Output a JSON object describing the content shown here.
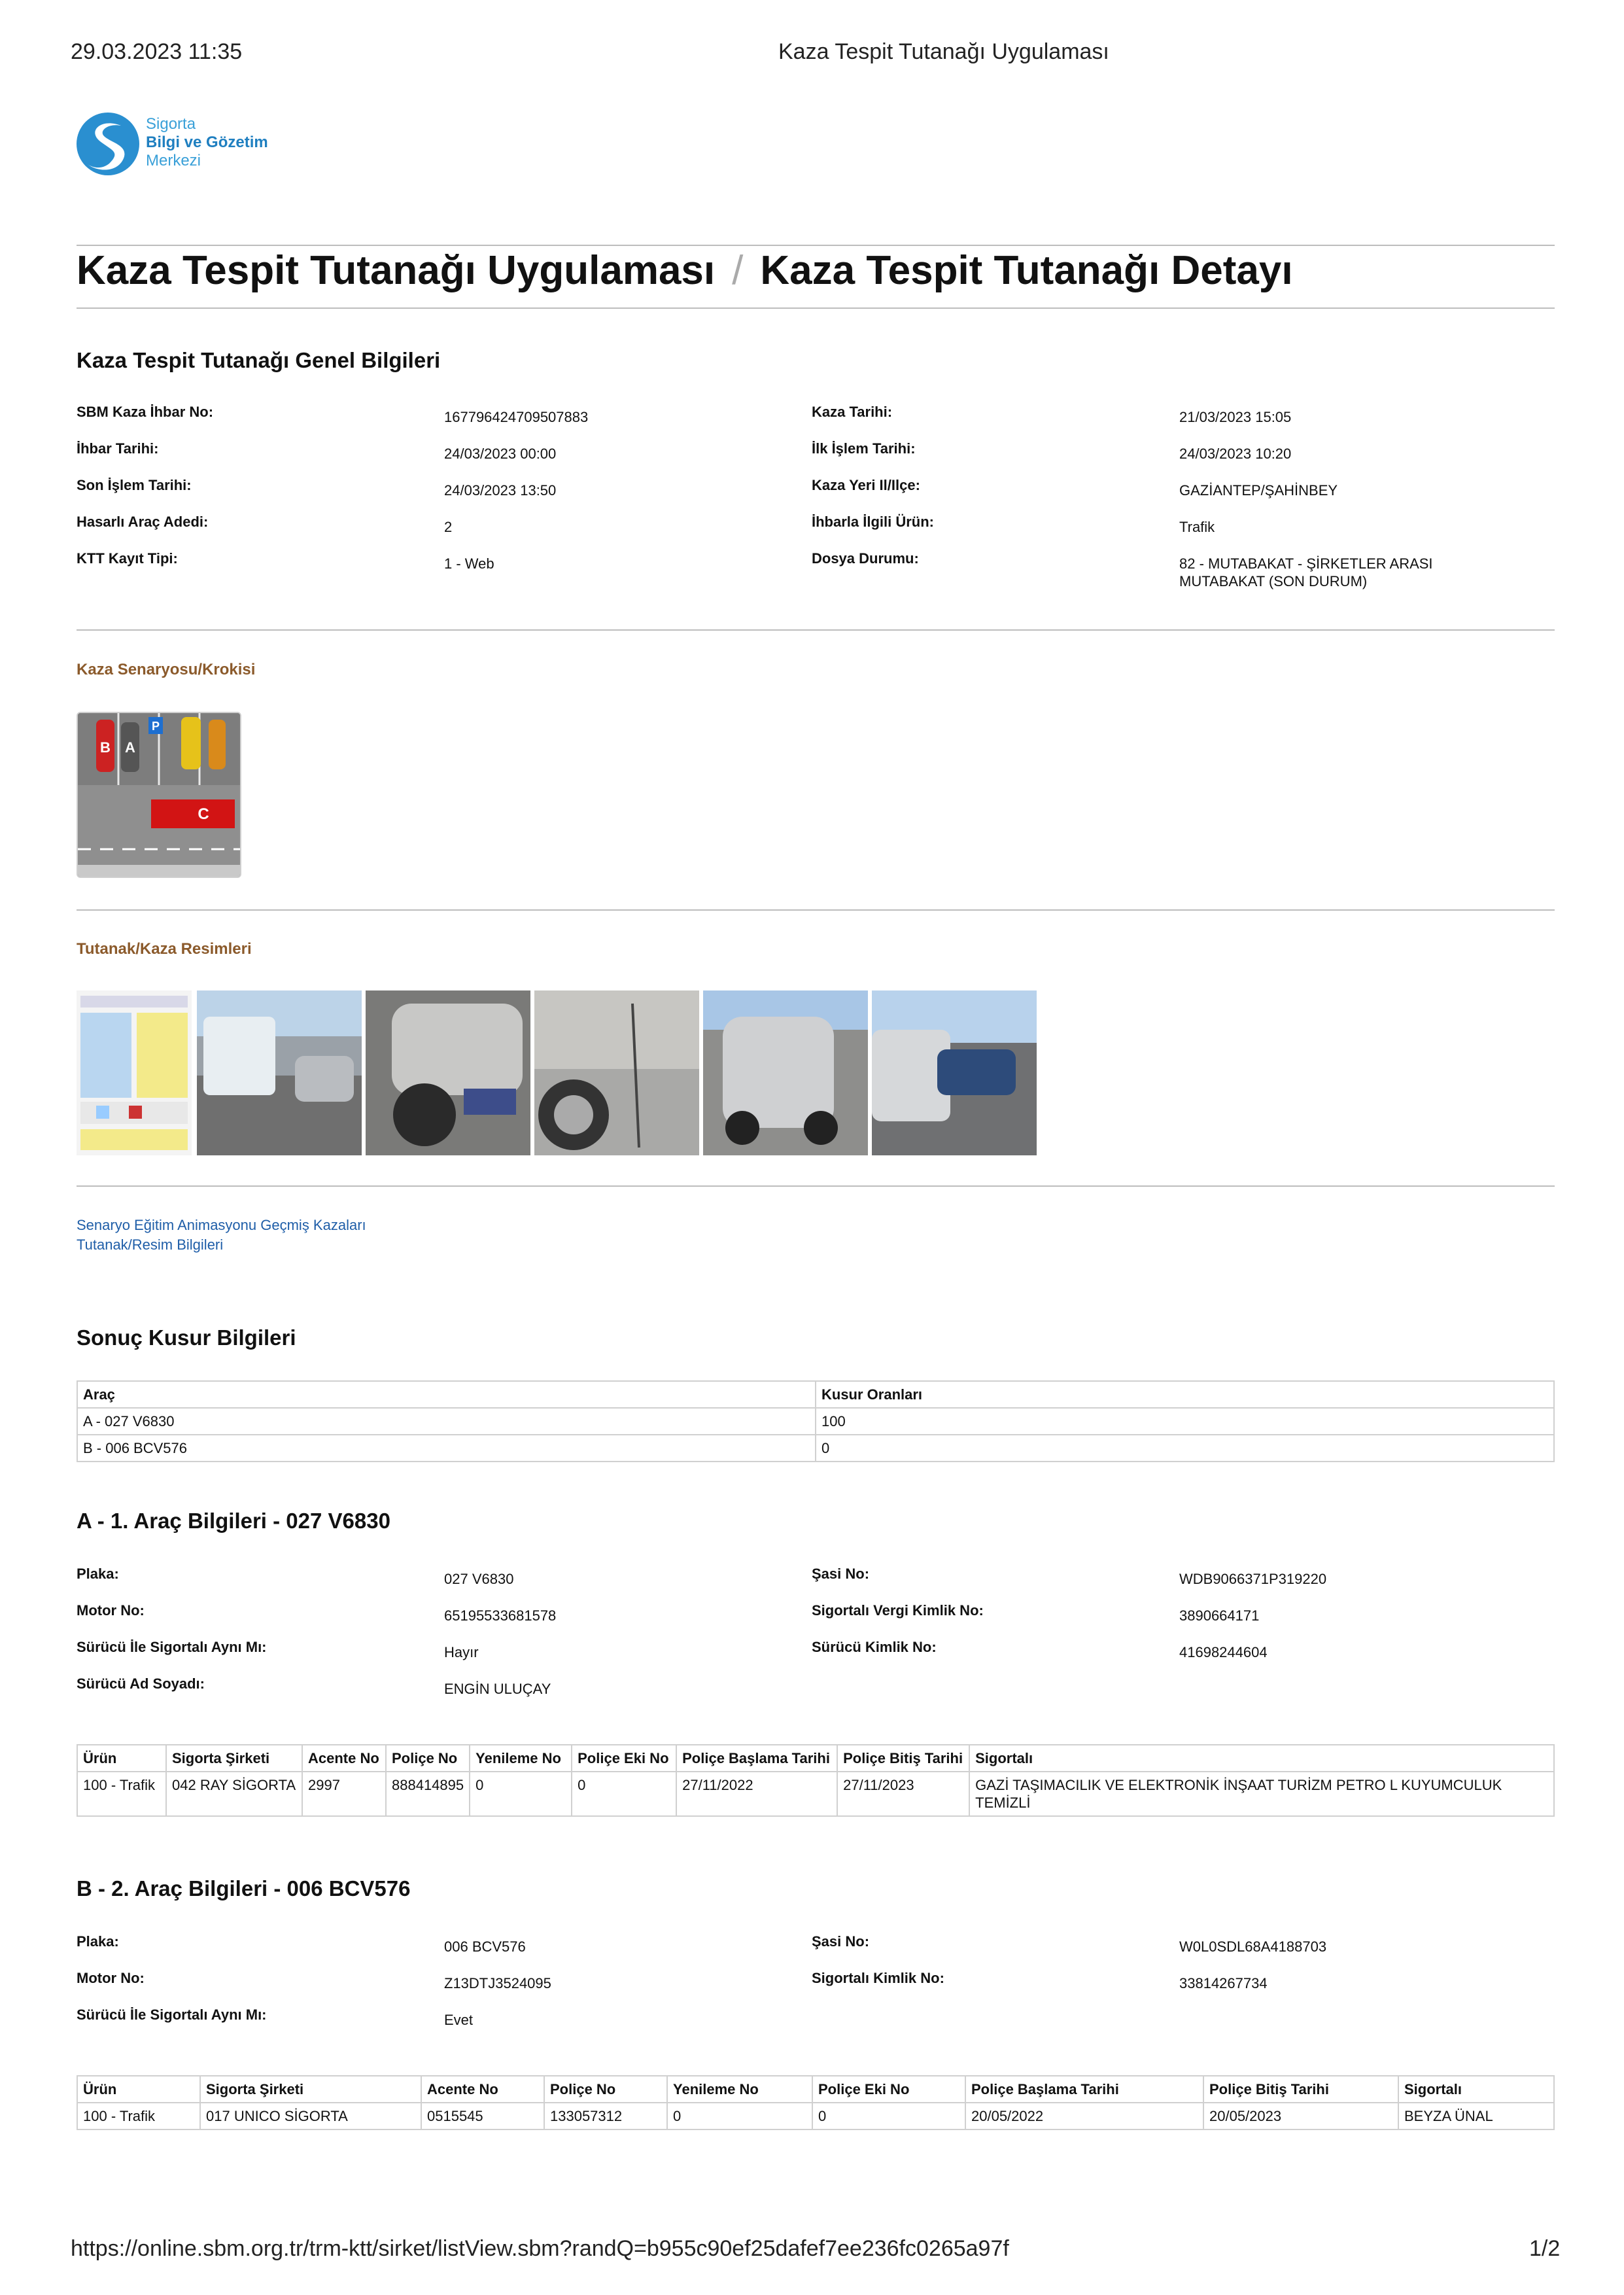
{
  "header": {
    "datetime": "29.03.2023 11:35",
    "page_title": "Kaza Tespit Tutanağı Uygulaması"
  },
  "logo": {
    "line1": "Sigorta",
    "line2": "Bilgi ve Gözetim",
    "line3": "Merkezi"
  },
  "title": {
    "part1": "Kaza Tespit Tutanağı Uygulaması",
    "separator": "/",
    "part2": "Kaza Tespit Tutanağı Detayı"
  },
  "general": {
    "heading": "Kaza Tespit Tutanağı Genel Bilgileri",
    "rows": [
      {
        "l1": "SBM Kaza İhbar No:",
        "v1": "167796424709507883",
        "l2": "Kaza Tarihi:",
        "v2": "21/03/2023 15:05"
      },
      {
        "l1": "İhbar Tarihi:",
        "v1": "24/03/2023 00:00",
        "l2": "İlk İşlem Tarihi:",
        "v2": "24/03/2023 10:20"
      },
      {
        "l1": "Son İşlem Tarihi:",
        "v1": "24/03/2023 13:50",
        "l2": "Kaza Yeri Il/Ilçe:",
        "v2": "GAZİANTEP/ŞAHİNBEY"
      },
      {
        "l1": "Hasarlı Araç Adedi:",
        "v1": "2",
        "l2": "İhbarla İlgili Ürün:",
        "v2": "Trafik"
      },
      {
        "l1": "KTT Kayıt Tipi:",
        "v1": "1 - Web",
        "l2": "Dosya Durumu:",
        "v2": "82 - MUTABAKAT - ŞİRKETLER ARASI MUTABAKAT (SON DURUM)"
      }
    ]
  },
  "scenario": {
    "heading": "Kaza Senaryosu/Krokisi",
    "labels": [
      "B",
      "A",
      "P",
      "C"
    ]
  },
  "photos": {
    "heading": "Tutanak/Kaza Resimleri"
  },
  "links": {
    "line1": "Senaryo Eğitim Animasyonu Geçmiş Kazaları",
    "line2": "Tutanak/Resim Bilgileri"
  },
  "fault": {
    "heading": "Sonuç Kusur Bilgileri",
    "columns": [
      "Araç",
      "Kusur Oranları"
    ],
    "rows": [
      [
        "A - 027 V6830",
        "100"
      ],
      [
        "B - 006 BCV576",
        "0"
      ]
    ]
  },
  "vehicleA": {
    "heading": "A - 1. Araç Bilgileri - 027 V6830",
    "rows": [
      {
        "l1": "Plaka:",
        "v1": "027 V6830",
        "l2": "Şasi No:",
        "v2": "WDB9066371P319220"
      },
      {
        "l1": "Motor No:",
        "v1": "65195533681578",
        "l2": "Sigortalı Vergi Kimlik No:",
        "v2": "3890664171"
      },
      {
        "l1": "Sürücü İle Sigortalı Aynı Mı:",
        "v1": "Hayır",
        "l2": "Sürücü Kimlik No:",
        "v2": "41698244604"
      },
      {
        "l1": "Sürücü Ad Soyadı:",
        "v1": "ENGİN ULUÇAY",
        "l2": "",
        "v2": ""
      }
    ],
    "policy_columns": [
      "Ürün",
      "Sigorta Şirketi",
      "Acente No",
      "Poliçe No",
      "Yenileme No",
      "Poliçe Eki No",
      "Poliçe Başlama Tarihi",
      "Poliçe Bitiş Tarihi",
      "Sigortalı"
    ],
    "policy_rows": [
      [
        "100 - Trafik",
        "042 RAY SİGORTA",
        "2997",
        "888414895",
        "0",
        "0",
        "27/11/2022",
        "27/11/2023",
        "GAZİ TAŞIMACILIK VE ELEKTRONİK İNŞAAT TURİZM PETRO L KUYUMCULUK TEMİZLİ"
      ]
    ]
  },
  "vehicleB": {
    "heading": "B - 2. Araç Bilgileri - 006 BCV576",
    "rows": [
      {
        "l1": "Plaka:",
        "v1": "006 BCV576",
        "l2": "Şasi No:",
        "v2": "W0L0SDL68A4188703"
      },
      {
        "l1": "Motor No:",
        "v1": "Z13DTJ3524095",
        "l2": "Sigortalı Kimlik No:",
        "v2": "33814267734"
      },
      {
        "l1": "Sürücü İle Sigortalı Aynı Mı:",
        "v1": "Evet",
        "l2": "",
        "v2": ""
      }
    ],
    "policy_columns": [
      "Ürün",
      "Sigorta Şirketi",
      "Acente No",
      "Poliçe No",
      "Yenileme No",
      "Poliçe Eki No",
      "Poliçe Başlama Tarihi",
      "Poliçe Bitiş Tarihi",
      "Sigortalı"
    ],
    "policy_rows": [
      [
        "100 - Trafik",
        "017 UNICO SİGORTA",
        "0515545",
        "133057312",
        "0",
        "0",
        "20/05/2022",
        "20/05/2023",
        "BEYZA ÜNAL"
      ]
    ]
  },
  "footer": {
    "url": "https://online.sbm.org.tr/trm-ktt/sirket/listView.sbm?randQ=b955c90ef25dafef7ee236fc0265a97f",
    "page": "1/2"
  }
}
